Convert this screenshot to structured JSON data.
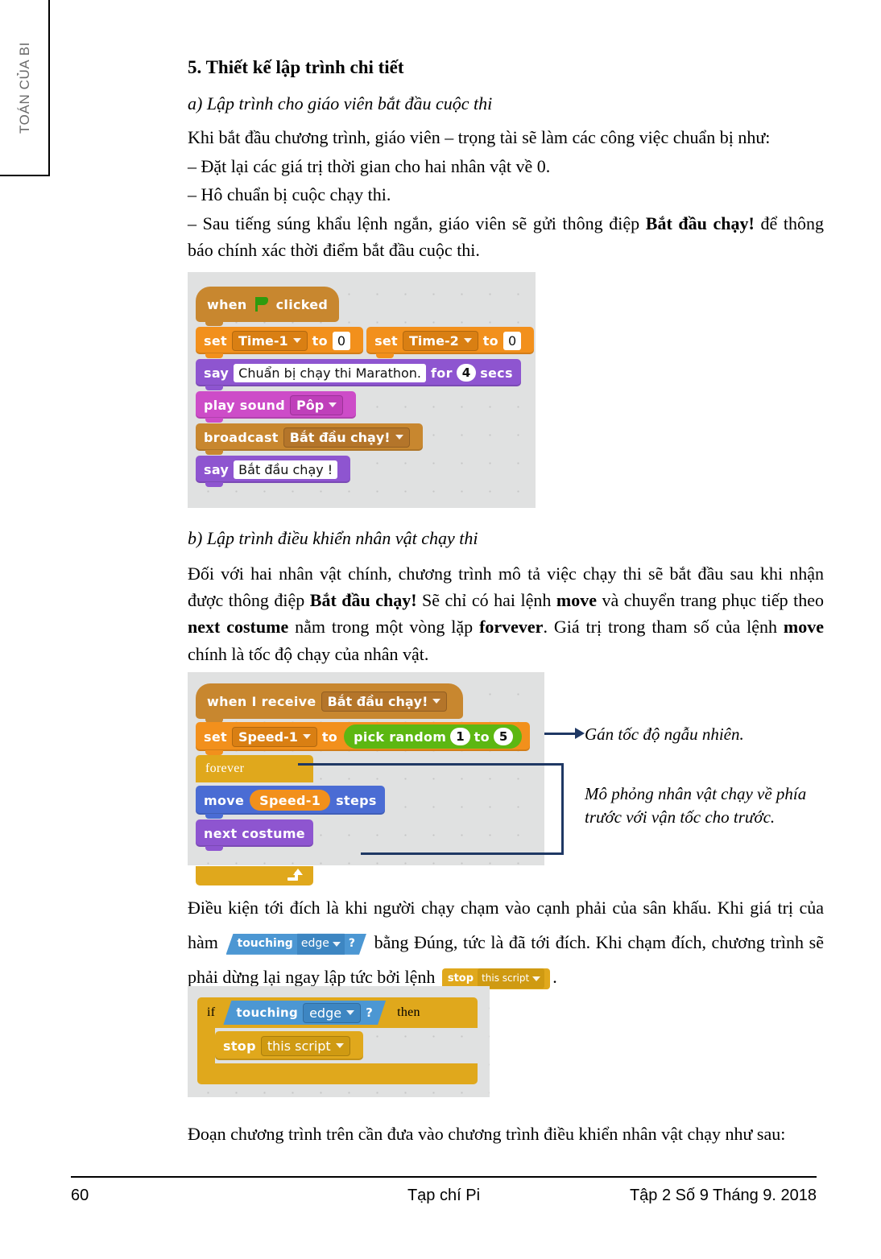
{
  "sidebar": {
    "running_head": "TOÁN CỦA BI"
  },
  "section": {
    "title": "5. Thiết kế lập trình chi tiết",
    "part_a_heading": "a) Lập trình cho giáo viên bắt đầu cuộc thi",
    "intro": "Khi bắt đầu chương trình, giáo viên – trọng tài sẽ làm các công việc chuẩn bị như:",
    "bullet_1": "– Đặt lại các giá trị thời gian cho hai nhân vật về 0.",
    "bullet_2": "– Hô chuẩn bị cuộc chạy thi.",
    "bullet_3_pre": "– Sau tiếng súng khẩu lệnh ngắn, giáo viên sẽ gửi thông điệp ",
    "bullet_3_bold": "Bắt đầu chạy!",
    "bullet_3_post": " để thông báo chính xác thời điểm bắt đầu cuộc thi.",
    "part_b_heading": "b) Lập trình điều khiển nhân vật chạy thi",
    "para_b_1": "Đối với hai nhân vật chính, chương trình mô tả việc chạy thi sẽ bắt đầu sau khi nhận được thông điệp ",
    "para_b_b1": "Bắt đầu chạy!",
    "para_b_2": " Sẽ chỉ có hai lệnh ",
    "para_b_b2": "move",
    "para_b_3": " và chuyển trang phục tiếp theo ",
    "para_b_b3": "next costume",
    "para_b_4": " nằm trong một vòng lặp ",
    "para_b_b4": "forvever",
    "para_b_5": ". Giá trị trong tham số của lệnh ",
    "para_b_b5": "move",
    "para_b_6": " chính là tốc độ chạy của nhân vật.",
    "para_c_1": "Điều kiện tới đích là khi người chạy chạm vào cạnh phải của sân khấu. Khi giá trị của hàm ",
    "para_c_2": " bằng Đúng, tức là đã tới đích. Khi chạm đích, chương trình sẽ phải dừng lại ngay lập tức bởi lệnh ",
    "para_c_3": ".",
    "para_d": "Đoạn chương trình trên cần đưa vào chương trình điều khiển nhân vật chạy như sau:"
  },
  "script_1": {
    "hat": {
      "when": "when",
      "flag_icon": "green-flag-icon",
      "clicked": "clicked"
    },
    "rows": [
      {
        "cmd": "set",
        "var": "Time-1",
        "to": "to",
        "value": "0"
      },
      {
        "cmd": "set",
        "var": "Time-2",
        "to": "to",
        "value": "0"
      }
    ],
    "say_for": {
      "cmd": "say",
      "message": "Chuẩn bị chạy thi Marathon.",
      "for": "for",
      "secs_value": "4",
      "secs": "secs"
    },
    "play_sound": {
      "cmd": "play sound",
      "sound": "Pôp"
    },
    "broadcast": {
      "cmd": "broadcast",
      "message": "Bắt đầu chạy!"
    },
    "say": {
      "cmd": "say",
      "message": "Bắt đầu chạy !"
    }
  },
  "script_2": {
    "hat": {
      "when_i_receive": "when I receive",
      "message": "Bắt đầu chạy!"
    },
    "set_row": {
      "cmd": "set",
      "var": "Speed-1",
      "to": "to",
      "op": "pick random",
      "from": "1",
      "mid": "to",
      "upto": "5"
    },
    "forever": {
      "label": "forever",
      "loop_icon": "loop-arrow-icon"
    },
    "move": {
      "cmd": "move",
      "var": "Speed-1",
      "unit": "steps"
    },
    "next_costume": {
      "cmd": "next costume"
    },
    "callout_1": "Gán tốc độ ngẫu nhiên.",
    "callout_2_line1": "Mô phỏng nhân vật chạy về phía",
    "callout_2_line2": "trước với vận tốc cho trước."
  },
  "inline_blocks": {
    "touching": {
      "cmd": "touching",
      "target": "edge",
      "q": "?"
    },
    "stop": {
      "cmd": "stop",
      "target": "this script"
    }
  },
  "script_3": {
    "if_row": {
      "if": "if",
      "touching": "touching",
      "target": "edge",
      "q": "?",
      "then": "then"
    },
    "stop_row": {
      "cmd": "stop",
      "target": "this script"
    }
  },
  "footer": {
    "page_number": "60",
    "journal": "Tạp chí Pi",
    "issue": "Tập 2 Số 9 Tháng 9. 2018"
  },
  "colors": {
    "event": "#c8872f",
    "data": "#f2901c",
    "looks": "#8e55d0",
    "sound": "#cd4cc8",
    "motion": "#4a6cd4",
    "control": "#e0a81c",
    "operators": "#5cb712",
    "sensing": "#4c97d3",
    "callout_line": "#1f3864",
    "canvas_bg": "#e0e1e1"
  }
}
